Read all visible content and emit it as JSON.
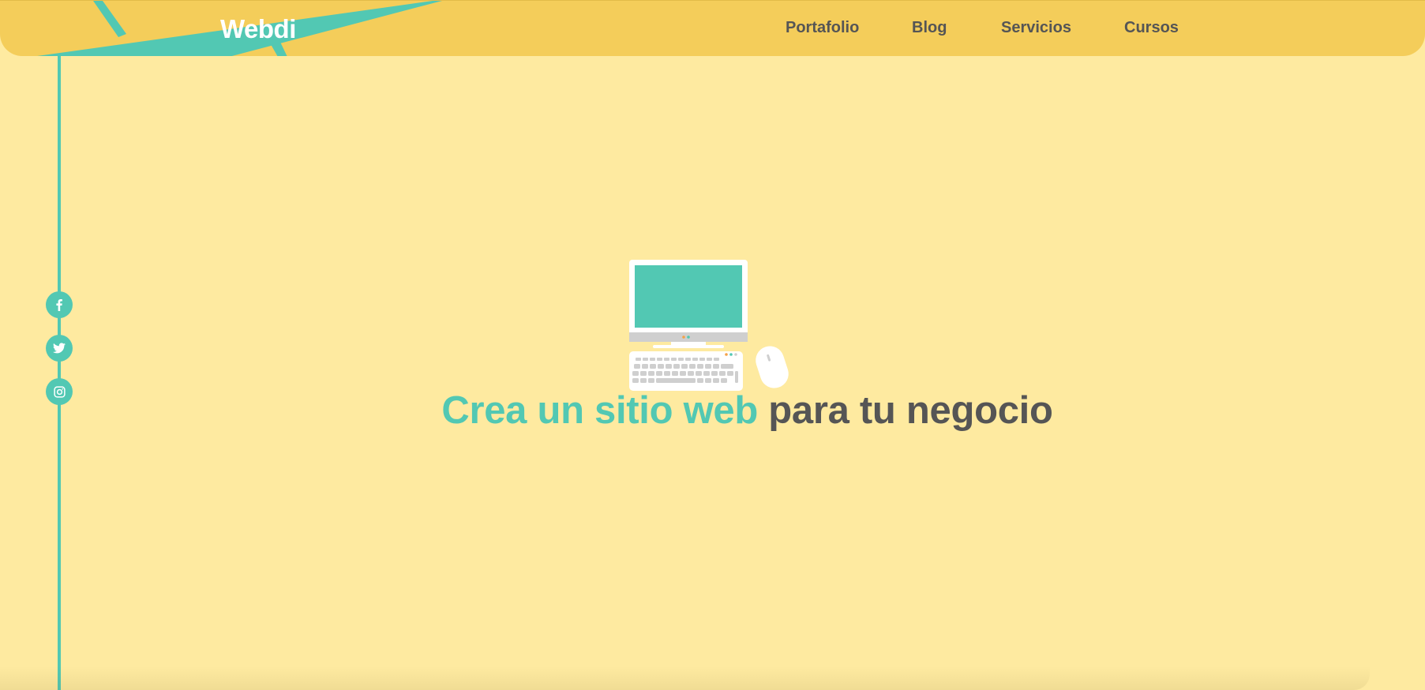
{
  "brand": {
    "logo_text": "Webdi",
    "colors": {
      "header_bg": "#f4cd5a",
      "page_bg": "#feeaa0",
      "accent": "#52c8b3",
      "text_dark": "#555555",
      "white": "#ffffff"
    }
  },
  "nav": {
    "items": [
      {
        "label": "Portafolio"
      },
      {
        "label": "Blog"
      },
      {
        "label": "Servicios"
      },
      {
        "label": "Cursos"
      }
    ]
  },
  "social": [
    {
      "icon": "facebook-icon"
    },
    {
      "icon": "twitter-icon"
    },
    {
      "icon": "instagram-icon"
    }
  ],
  "hero": {
    "headline_accent": "Crea un sitio web",
    "headline_rest": "para tu negocio",
    "illustration": "desktop-computer-illustration"
  }
}
